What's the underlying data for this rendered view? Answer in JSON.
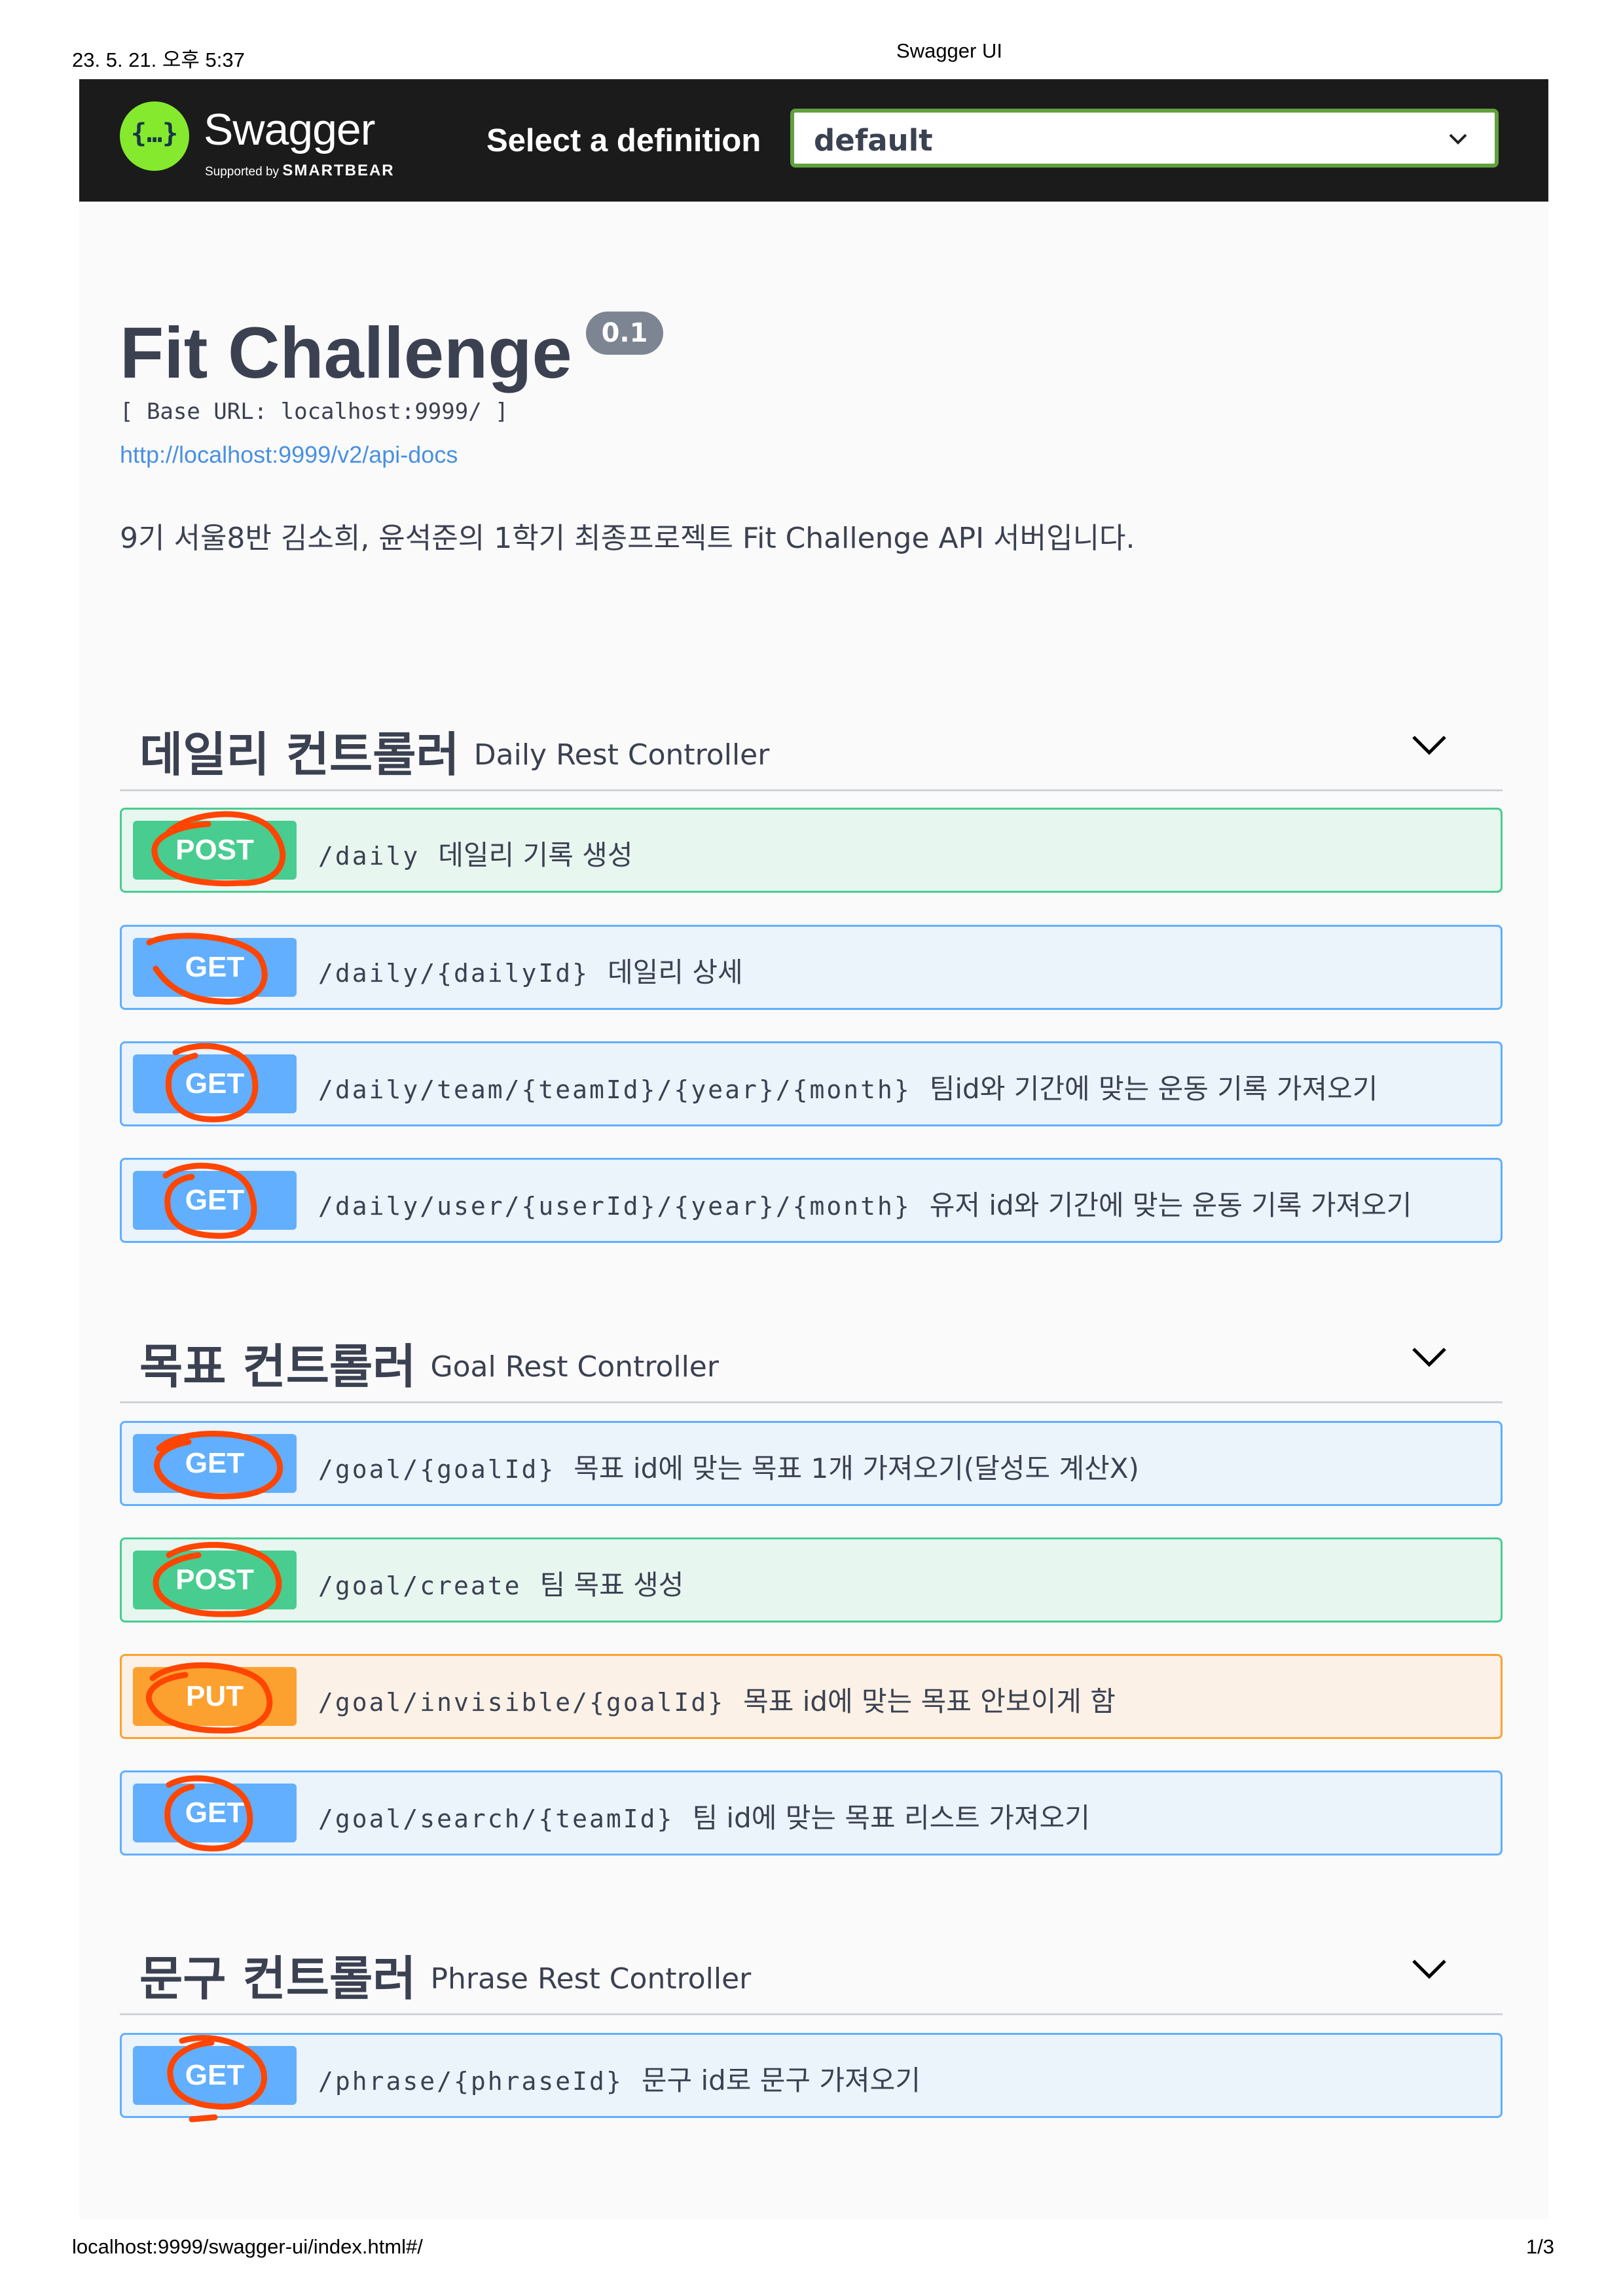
{
  "print": {
    "date": "23. 5. 21. 오후 5:37",
    "title": "Swagger UI",
    "url": "localhost:9999/swagger-ui/index.html#/",
    "page": "1/3"
  },
  "topbar": {
    "logo_mark": "{…}",
    "logo_word": "Swagger",
    "logo_sub_prefix": "Supported by",
    "logo_sub_brand": "SMARTBEAR",
    "select_label": "Select a definition",
    "select_value": "default"
  },
  "info": {
    "title": "Fit Challenge",
    "version": "0.1",
    "base_url": "[ Base URL: localhost:9999/ ]",
    "docs_link": "http://localhost:9999/v2/api-docs",
    "description": "9기 서울8반 김소희, 윤석준의 1학기 최종프로젝트 Fit Challenge API 서버입니다."
  },
  "tags": [
    {
      "name": "데일리 컨트롤러",
      "description": "Daily Rest Controller",
      "operations": [
        {
          "method": "POST",
          "path": "/daily",
          "summary": "데일리 기록 생성"
        },
        {
          "method": "GET",
          "path": "/daily/{dailyId}",
          "summary": "데일리 상세"
        },
        {
          "method": "GET",
          "path": "/daily/team/{teamId}/{year}/{month}",
          "summary": "팀id와 기간에 맞는 운동 기록 가져오기"
        },
        {
          "method": "GET",
          "path": "/daily/user/{userId}/{year}/{month}",
          "summary": "유저 id와 기간에 맞는 운동 기록 가져오기"
        }
      ]
    },
    {
      "name": "목표 컨트롤러",
      "description": "Goal Rest Controller",
      "operations": [
        {
          "method": "GET",
          "path": "/goal/{goalId}",
          "summary": "목표 id에 맞는 목표 1개 가져오기(달성도 계산X)"
        },
        {
          "method": "POST",
          "path": "/goal/create",
          "summary": "팀 목표 생성"
        },
        {
          "method": "PUT",
          "path": "/goal/invisible/{goalId}",
          "summary": "목표 id에 맞는 목표 안보이게 함"
        },
        {
          "method": "GET",
          "path": "/goal/search/{teamId}",
          "summary": "팀 id에 맞는 목표 리스트 가져오기"
        }
      ]
    },
    {
      "name": "문구 컨트롤러",
      "description": "Phrase Rest Controller",
      "operations": [
        {
          "method": "GET",
          "path": "/phrase/{phraseId}",
          "summary": "문구 id로 문구 가져오기"
        }
      ]
    }
  ],
  "colors": {
    "post": "#49cc90",
    "get": "#61affe",
    "put": "#fca130",
    "annotation": "#ff4500",
    "topbar": "#1b1b1b",
    "logo": "#85ea2d"
  }
}
